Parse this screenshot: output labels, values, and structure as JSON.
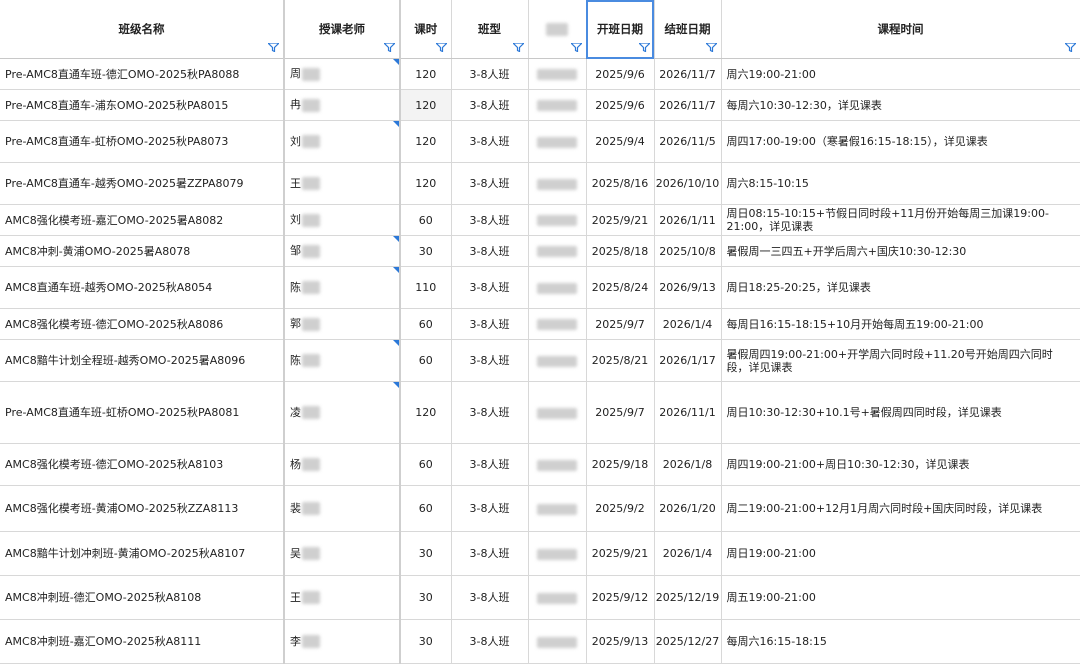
{
  "headers": [
    "班级名称",
    "授课老师",
    "课时",
    "班型",
    "",
    "开班日期",
    "结班日期",
    "课程时间"
  ],
  "rows": [
    {
      "name": "Pre-AMC8直通车班-德汇OMO-2025秋PA8088",
      "teacher": "周",
      "hours": "120",
      "type": "3-8人班",
      "start": "2025/9/6",
      "end": "2026/11/7",
      "time": "周六19:00-21:00"
    },
    {
      "name": "Pre-AMC8直通车-浦东OMO-2025秋PA8015",
      "teacher": "冉",
      "hours": "120",
      "type": "3-8人班",
      "start": "2025/9/6",
      "end": "2026/11/7",
      "time": "每周六10:30-12:30，详见课表"
    },
    {
      "name": "Pre-AMC8直通车-虹桥OMO-2025秋PA8073",
      "teacher": "刘",
      "hours": "120",
      "type": "3-8人班",
      "start": "2025/9/4",
      "end": "2026/11/5",
      "time": "周四17:00-19:00（寒暑假16:15-18:15），详见课表"
    },
    {
      "name": "Pre-AMC8直通车-越秀OMO-2025暑ZZPA8079",
      "teacher": "王",
      "hours": "120",
      "type": "3-8人班",
      "start": "2025/8/16",
      "end": "2026/10/10",
      "time": "周六8:15-10:15"
    },
    {
      "name": "AMC8强化模考班-嘉汇OMO-2025暑A8082",
      "teacher": "刘",
      "hours": "60",
      "type": "3-8人班",
      "start": "2025/9/21",
      "end": "2026/1/11",
      "time": "周日08:15-10:15+节假日同时段+11月份开始每周三加课19:00-21:00，详见课表"
    },
    {
      "name": "AMC8冲刺-黄浦OMO-2025暑A8078",
      "teacher": "邹",
      "hours": "30",
      "type": "3-8人班",
      "start": "2025/8/18",
      "end": "2025/10/8",
      "time": "暑假周一三四五+开学后周六+国庆10:30-12:30"
    },
    {
      "name": "AMC8直通车班-越秀OMO-2025秋A8054",
      "teacher": "陈",
      "hours": "110",
      "type": "3-8人班",
      "start": "2025/8/24",
      "end": "2026/9/13",
      "time": "周日18:25-20:25，详见课表"
    },
    {
      "name": "AMC8强化模考班-德汇OMO-2025秋A8086",
      "teacher": "郭",
      "hours": "60",
      "type": "3-8人班",
      "start": "2025/9/7",
      "end": "2026/1/4",
      "time": "每周日16:15-18:15+10月开始每周五19:00-21:00"
    },
    {
      "name": "AMC8黯牛计划全程班-越秀OMO-2025暑A8096",
      "teacher": "陈",
      "hours": "60",
      "type": "3-8人班",
      "start": "2025/8/21",
      "end": "2026/1/17",
      "time": "暑假周四19:00-21:00+开学周六同时段+11.20号开始周四六同时段，详见课表"
    },
    {
      "name": "Pre-AMC8直通车班-虹桥OMO-2025秋PA8081",
      "teacher": "凌",
      "hours": "120",
      "type": "3-8人班",
      "start": "2025/9/7",
      "end": "2026/11/1",
      "time": "周日10:30-12:30+10.1号+暑假周四同时段，详见课表"
    },
    {
      "name": "AMC8强化模考班-德汇OMO-2025秋A8103",
      "teacher": "杨",
      "hours": "60",
      "type": "3-8人班",
      "start": "2025/9/18",
      "end": "2026/1/8",
      "time": "周四19:00-21:00+周日10:30-12:30，详见课表"
    },
    {
      "name": "AMC8强化模考班-黄浦OMO-2025秋ZZA8113",
      "teacher": "裴",
      "hours": "60",
      "type": "3-8人班",
      "start": "2025/9/2",
      "end": "2026/1/20",
      "time": "周二19:00-21:00+12月1月周六同时段+国庆同时段，详见课表"
    },
    {
      "name": "AMC8黯牛计划冲刺班-黄浦OMO-2025秋A8107",
      "teacher": "吴",
      "hours": "30",
      "type": "3-8人班",
      "start": "2025/9/21",
      "end": "2026/1/4",
      "time": "周日19:00-21:00"
    },
    {
      "name": "AMC8冲刺班-德汇OMO-2025秋A8108",
      "teacher": "王",
      "hours": "30",
      "type": "3-8人班",
      "start": "2025/9/12",
      "end": "2025/12/19",
      "time": "周五19:00-21:00"
    },
    {
      "name": "AMC8冲刺班-嘉汇OMO-2025秋A8111",
      "teacher": "李",
      "hours": "30",
      "type": "3-8人班",
      "start": "2025/9/13",
      "end": "2025/12/27",
      "time": "每周六16:15-18:15"
    }
  ],
  "colors": {
    "accent": "#2b78d8",
    "grid": "#d8d8d8",
    "blur": "#cfcfcf"
  }
}
